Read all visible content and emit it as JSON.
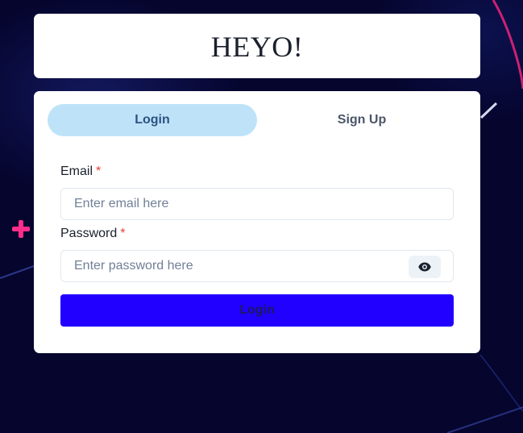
{
  "header": {
    "title": "HEYO!"
  },
  "tabs": [
    {
      "label": "Login",
      "active": true
    },
    {
      "label": "Sign Up",
      "active": false
    }
  ],
  "form": {
    "email": {
      "label": "Email",
      "required_mark": "*",
      "placeholder": "Enter email here",
      "value": ""
    },
    "password": {
      "label": "Password",
      "required_mark": "*",
      "placeholder": "Enter password here",
      "value": ""
    },
    "submit_label": "Login"
  },
  "icons": {
    "password_toggle": "eye-icon"
  },
  "colors": {
    "background": "#05052e",
    "active_tab": "#bee3f8",
    "active_tab_text": "#2c5282",
    "submit_button": "#2200ff",
    "required": "#e53e3e",
    "neon_pink": "#ff2d8a"
  }
}
